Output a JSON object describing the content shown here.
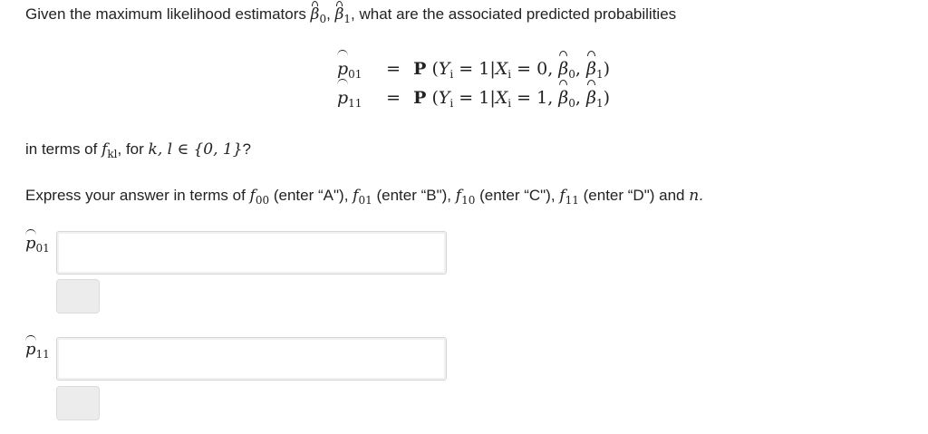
{
  "question": {
    "line1_prefix": "Given the maximum likelihood estimators",
    "beta0_symbol": "β",
    "beta0_sub": "0",
    "comma": ",",
    "beta1_symbol": "β",
    "beta1_sub": "1",
    "line1_suffix": ", what are the associated predicted probabilities",
    "line2_prefix": "in terms of",
    "f_symbol": "f",
    "f_sub": "kl",
    "line2_middle": ", for",
    "line2_math": "k, l ∈ {0, 1}",
    "line2_suffix": "?",
    "line3_prefix": "Express your answer in terms of",
    "f00_sub": "00",
    "f00_enter": "(enter “A\"),",
    "f01_sub": "01",
    "f01_enter": "(enter “B\"),",
    "f10_sub": "10",
    "f10_enter": "(enter “C\"),",
    "f11_sub": "11",
    "f11_enter": "(enter “D\") and",
    "n_symbol": "n",
    "period": "."
  },
  "equations": [
    {
      "lhs_p": "p",
      "lhs_sub": "01",
      "sign": "=",
      "P": "P",
      "open": "(",
      "Y": "Y",
      "Y_sub": "i",
      "mid1": " = 1|",
      "X": "X",
      "X_sub": "i",
      "mid2": " = 0, ",
      "b0": "β",
      "b0_sub": "0",
      "sep": ", ",
      "b1": "β",
      "b1_sub": "1",
      "close": ")"
    },
    {
      "lhs_p": "p",
      "lhs_sub": "11",
      "sign": "=",
      "P": "P",
      "open": "(",
      "Y": "Y",
      "Y_sub": "i",
      "mid1": " = 1|",
      "X": "X",
      "X_sub": "i",
      "mid2": " = 1, ",
      "b0": "β",
      "b0_sub": "0",
      "sep": ", ",
      "b1": "β",
      "b1_sub": "1",
      "close": ")"
    }
  ],
  "answers": [
    {
      "label_p": "p",
      "label_sub": "01",
      "value": "",
      "placeholder": ""
    },
    {
      "label_p": "p",
      "label_sub": "11",
      "value": "",
      "placeholder": ""
    }
  ]
}
